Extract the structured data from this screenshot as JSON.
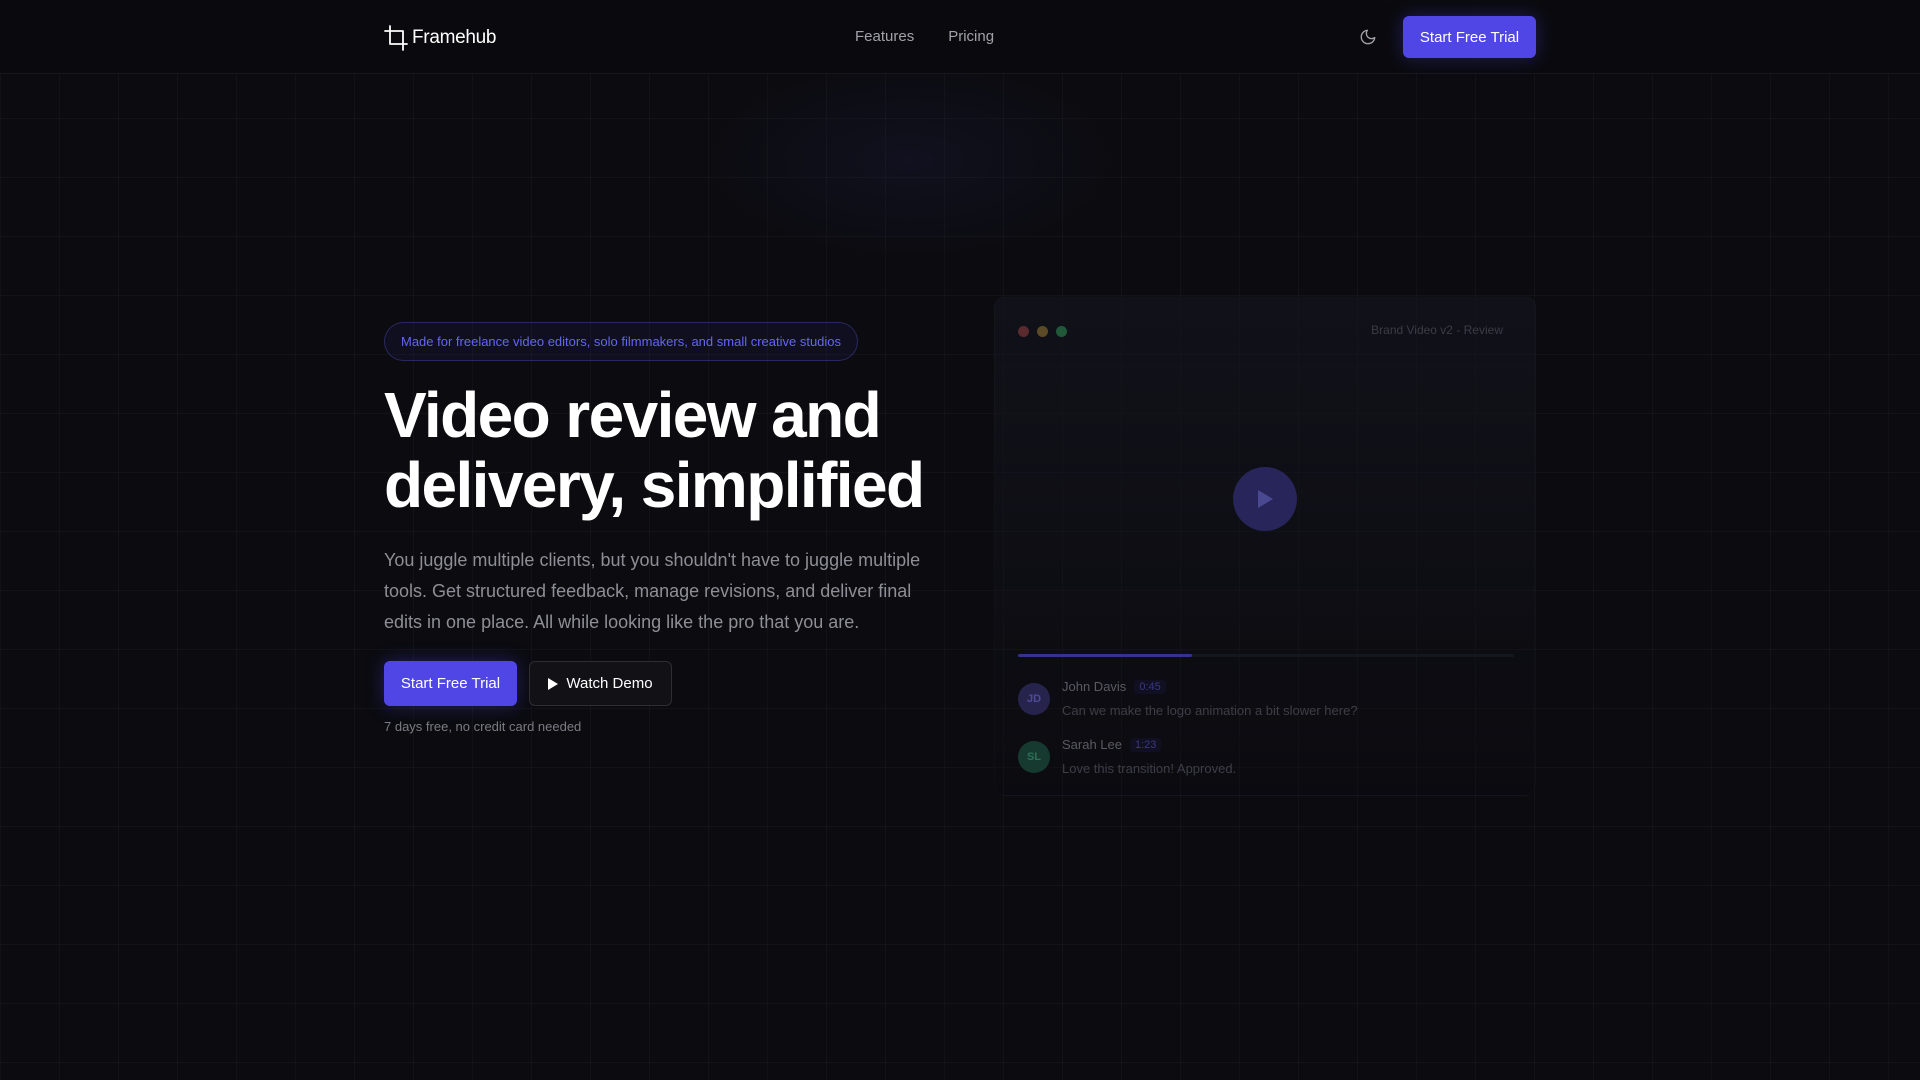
{
  "header": {
    "brand": "Framehub",
    "nav": [
      {
        "label": "Features"
      },
      {
        "label": "Pricing"
      }
    ],
    "cta_label": "Start Free Trial",
    "theme_icon": "moon-icon"
  },
  "hero": {
    "badge": "Made for freelance video editors, solo filmmakers, and small creative studios",
    "title_line1": "Video review and",
    "title_line2": "delivery, simplified",
    "subtitle": "You juggle multiple clients, but you shouldn't have to juggle multiple tools. Get structured feedback, manage revisions, and deliver final edits in one place. All while looking like the pro that you are.",
    "primary_cta": "Start Free Trial",
    "secondary_cta": "Watch Demo",
    "note": "7 days free, no credit card needed"
  },
  "preview": {
    "window_title": "Brand Video v2 - Review",
    "progress_fraction": 0.35,
    "comments": [
      {
        "initials": "JD",
        "name": "John Davis",
        "time": "0:45",
        "text": "Can we make the logo animation a bit slower here?"
      },
      {
        "initials": "SL",
        "name": "Sarah Lee",
        "time": "1:23",
        "text": "Love this transition! Approved."
      }
    ]
  },
  "colors": {
    "background": "#0b0b10",
    "accent": "#4f46e5",
    "muted_text": "#8e8e96"
  }
}
